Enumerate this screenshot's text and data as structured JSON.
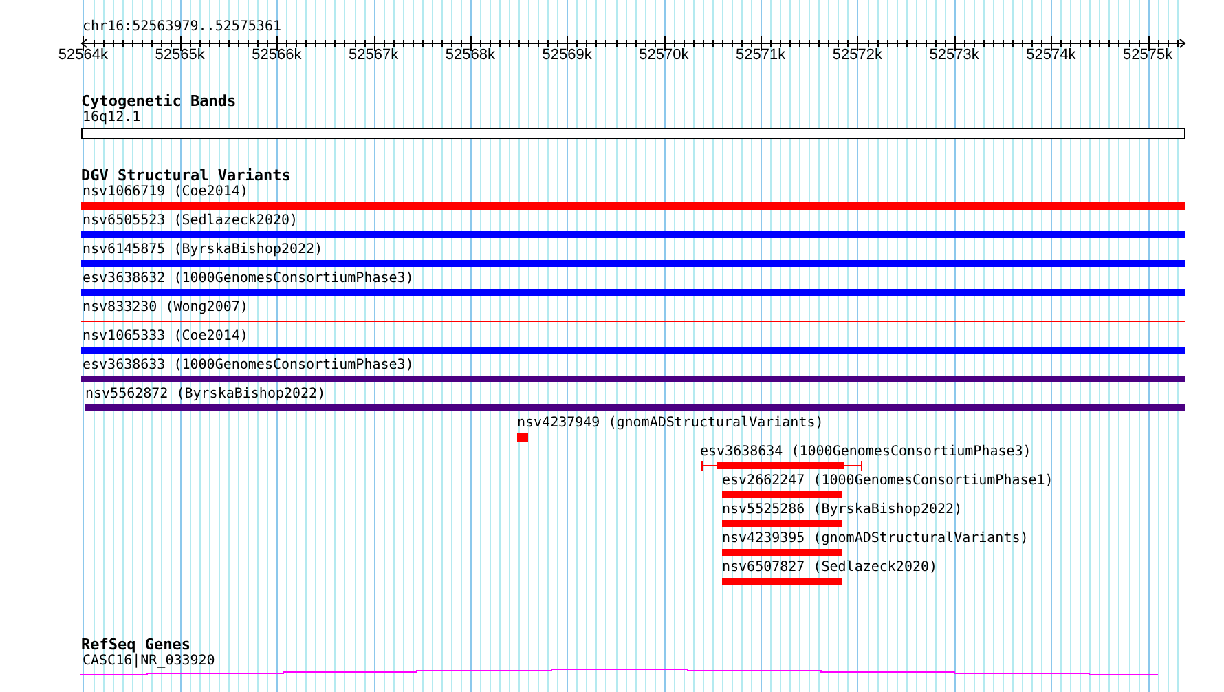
{
  "ruler": {
    "location": "chr16:52563979..52575361",
    "ticks": [
      "52564k",
      "52565k",
      "52566k",
      "52567k",
      "52568k",
      "52569k",
      "52570k",
      "52571k",
      "52572k",
      "52573k",
      "52574k",
      "52575k"
    ]
  },
  "tracks": [
    {
      "title": "Cytogenetic Bands",
      "features": [
        {
          "label": "16q12.1",
          "kind": "band"
        }
      ]
    },
    {
      "title": "DGV Structural Variants",
      "features": [
        {
          "label": "nsv1066719 (Coe2014)",
          "kind": "bar",
          "color": "#ff0000"
        },
        {
          "label": "nsv6505523 (Sedlazeck2020)",
          "kind": "bar",
          "color": "#0000ff"
        },
        {
          "label": "nsv6145875 (ByrskaBishop2022)",
          "kind": "bar",
          "color": "#0000ff"
        },
        {
          "label": "esv3638632 (1000GenomesConsortiumPhase3)",
          "kind": "bar",
          "color": "#0000ff"
        },
        {
          "label": "nsv833230 (Wong2007)",
          "kind": "line",
          "color": "#ff0000"
        },
        {
          "label": "nsv1065333 (Coe2014)",
          "kind": "bar",
          "color": "#0000ff"
        },
        {
          "label": "esv3638633 (1000GenomesConsortiumPhase3)",
          "kind": "bar",
          "color": "#4b0082"
        },
        {
          "label": "nsv5562872 (ByrskaBishop2022)",
          "kind": "bar",
          "color": "#4b0082"
        },
        {
          "label": "nsv4237949 (gnomADStructuralVariants)",
          "kind": "bar",
          "color": "#ff0000"
        },
        {
          "label": "esv3638634 (1000GenomesConsortiumPhase3)",
          "kind": "whisker",
          "color": "#ff0000"
        },
        {
          "label": "esv2662247 (1000GenomesConsortiumPhase1)",
          "kind": "bar",
          "color": "#ff0000"
        },
        {
          "label": "nsv5525286 (ByrskaBishop2022)",
          "kind": "bar",
          "color": "#ff0000"
        },
        {
          "label": "nsv4239395 (gnomADStructuralVariants)",
          "kind": "bar",
          "color": "#ff0000"
        },
        {
          "label": "nsv6507827 (Sedlazeck2020)",
          "kind": "bar",
          "color": "#ff0000"
        }
      ]
    },
    {
      "title": "RefSeq Genes",
      "features": [
        {
          "label": "CASC16|NR_033920",
          "kind": "gene"
        }
      ]
    }
  ]
}
